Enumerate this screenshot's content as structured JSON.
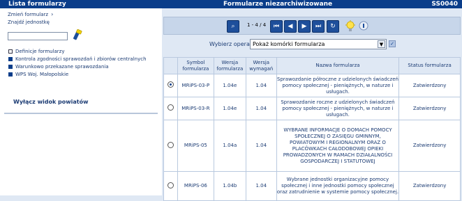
{
  "titlebar": {
    "left": "Lista formularzy",
    "center": "Formularze niezarchiwizowane",
    "right": "SS0040"
  },
  "sidebar": {
    "change_form": "Zmień formularz",
    "find_unit": "Znajdź jednostkę",
    "search_value": "",
    "menu": [
      {
        "label": "Definicje formularzy",
        "filled": false
      },
      {
        "label": "Kontrola zgodności sprawozdań i zbiorów centralnych",
        "filled": true
      },
      {
        "label": "Warunkowo przekazane sprawozdania",
        "filled": true
      },
      {
        "label": "WPS Woj. Małopolskie",
        "filled": true
      }
    ],
    "disable_county": "Wyłącz widok powiatów"
  },
  "navbar": {
    "counter": "1 - 4 / 4",
    "icons": [
      "search-icon",
      "first-page-icon",
      "prev-page-icon",
      "next-page-icon",
      "last-page-icon",
      "refresh-icon",
      "lightbulb-icon",
      "help-icon"
    ]
  },
  "operation": {
    "label": "Wybierz operację:",
    "selected": "Pokaż komórki formularza"
  },
  "table": {
    "headers": [
      "",
      "Symbol formularza",
      "Wersja formularza",
      "Wersja wymagań",
      "Nazwa formularza",
      "Status formularza"
    ],
    "rows": [
      {
        "selected": true,
        "symbol": "MRiPS-03-P",
        "version": "1.04e",
        "req": "1.04",
        "name": "Sprawozdanie półroczne z udzielonych świadczeń pomocy społecznej - pieniężnych, w naturze i usługach.",
        "status": "Zatwierdzony"
      },
      {
        "selected": false,
        "symbol": "MRiPS-03-R",
        "version": "1.04e",
        "req": "1.04",
        "name": "Sprawozdanie roczne z udzielonych świadczeń pomocy społecznej - pieniężnych, w naturze i usługach.",
        "status": "Zatwierdzony"
      },
      {
        "selected": false,
        "symbol": "MRiPS-05",
        "version": "1.04a",
        "req": "1.04",
        "name": "WYBRANE INFORMACJE O DOMACH POMOCY SPOŁECZNEJ O ZASIĘGU GMINNYM, POWIATOWYM I REGIONALNYM ORAZ O PLACÓWKACH CAŁODOBOWEJ OPIEKI PROWADZONYCH W RAMACH DZIAŁALNOŚCI GOSPODARCZEJ I STATUTOWEJ",
        "status": "Zatwierdzony"
      },
      {
        "selected": false,
        "symbol": "MRiPS-06",
        "version": "1.04b",
        "req": "1.04",
        "name": "Wybrane jednostki organizacyjne pomocy społecznej i inne jednostki pomocy społecznej oraz zatrudnienie w systemie pomocy społecznej.",
        "status": "Zatwierdzony"
      }
    ]
  }
}
